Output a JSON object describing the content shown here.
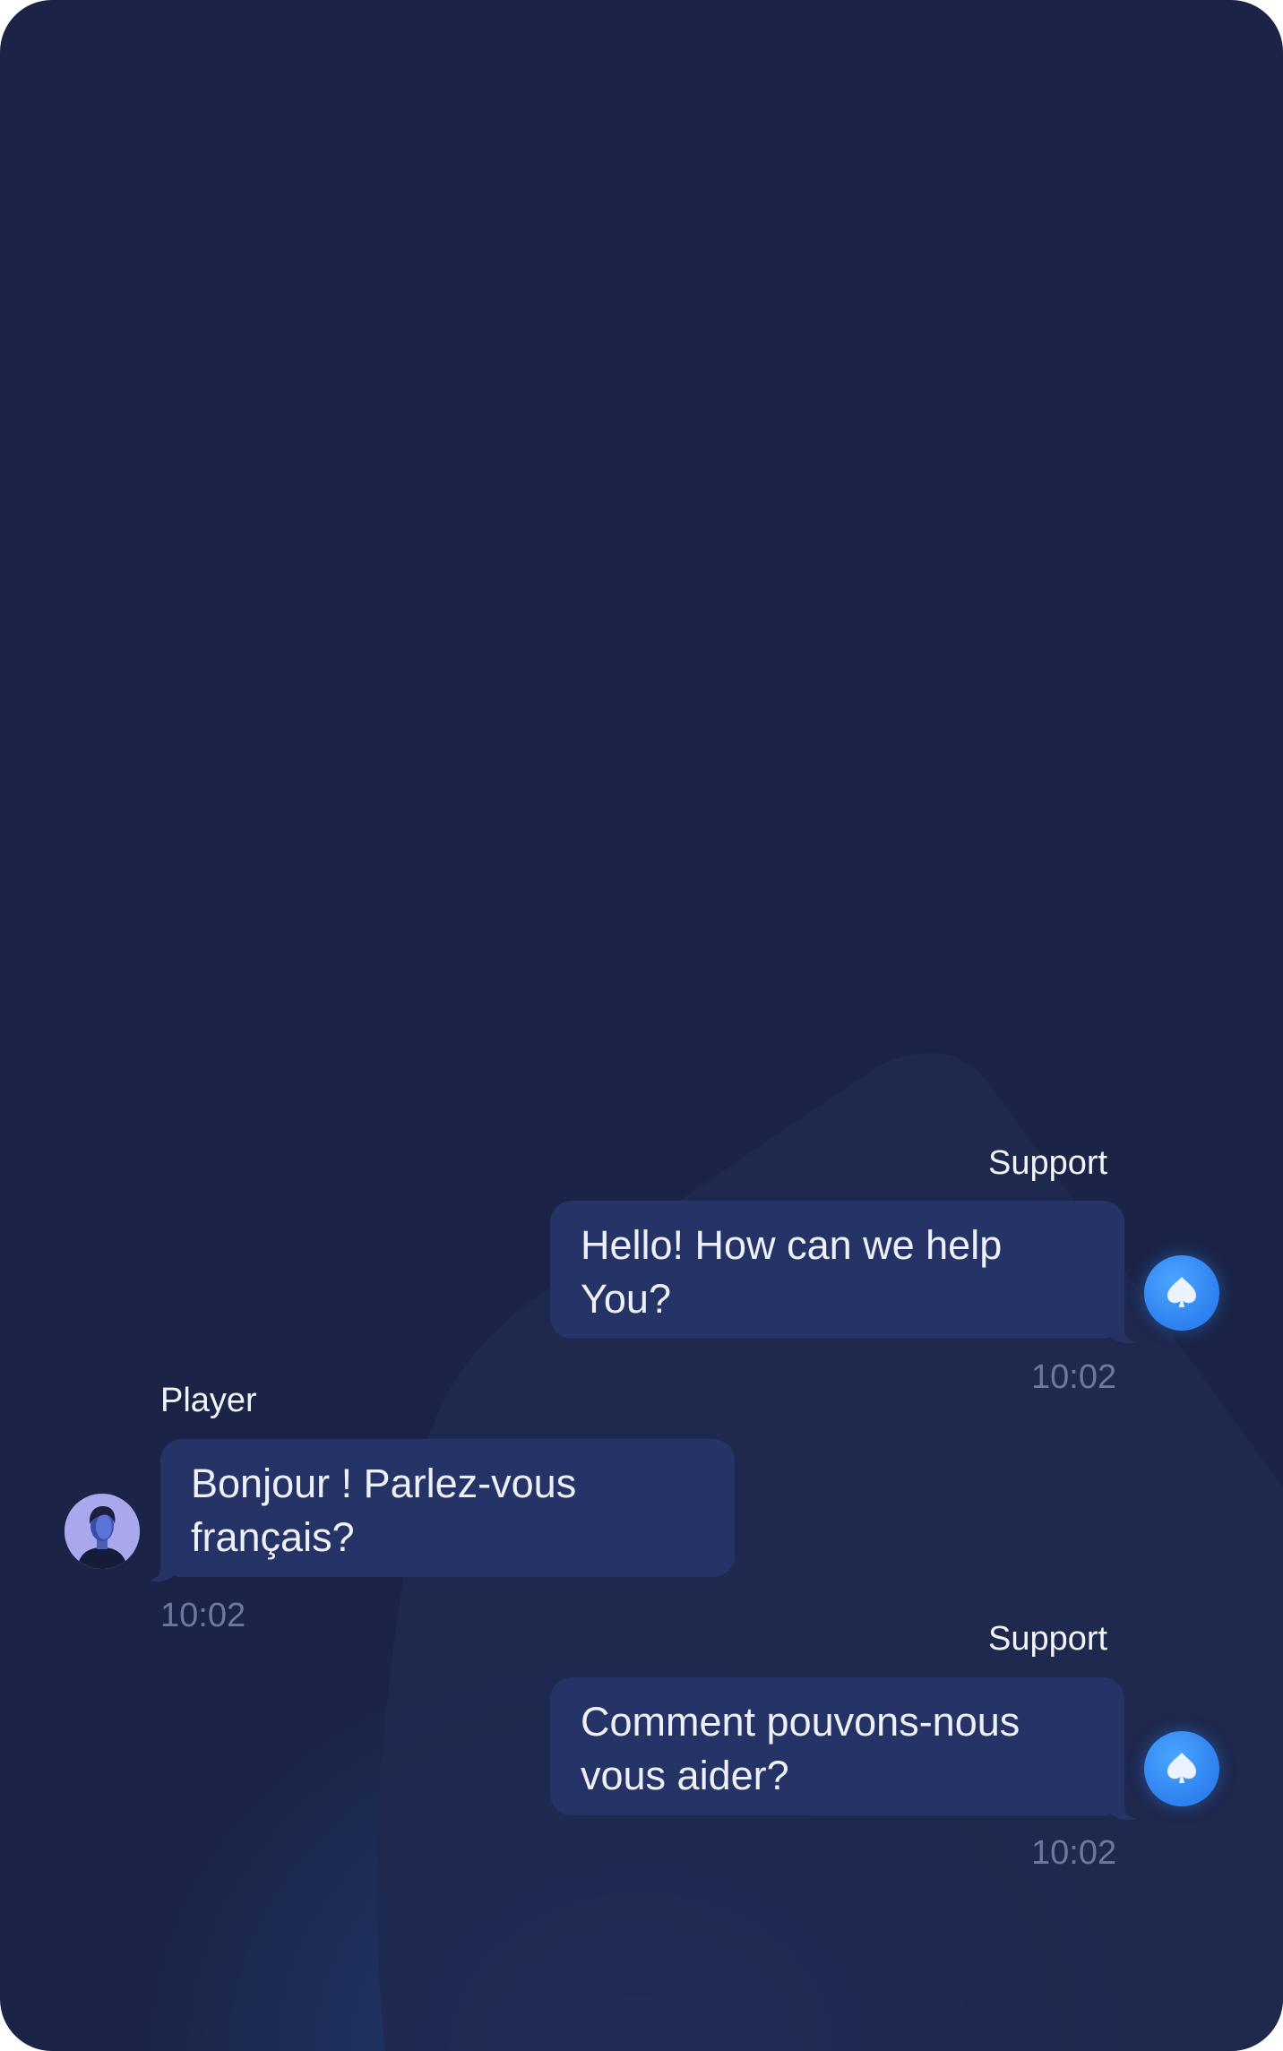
{
  "messages": [
    {
      "role": "support",
      "sender": "Support",
      "text_lines": [
        "Hello! How can we help",
        "You?"
      ],
      "time": "10:02",
      "avatar_icon": "spade-icon"
    },
    {
      "role": "player",
      "sender": "Player",
      "text_lines": [
        "Bonjour ! Parlez-vous",
        "français?"
      ],
      "time": "10:02",
      "avatar_icon": "player-avatar-photo"
    },
    {
      "role": "support",
      "sender": "Support",
      "text_lines": [
        "Comment pouvons-nous",
        "vous aider?"
      ],
      "time": "10:02",
      "avatar_icon": "spade-icon"
    }
  ],
  "colors": {
    "background": "#1b2446",
    "bubble": "#263366",
    "support_avatar": "#2f80f0",
    "time_text": "#6b789f",
    "message_text": "#eef1fa"
  }
}
